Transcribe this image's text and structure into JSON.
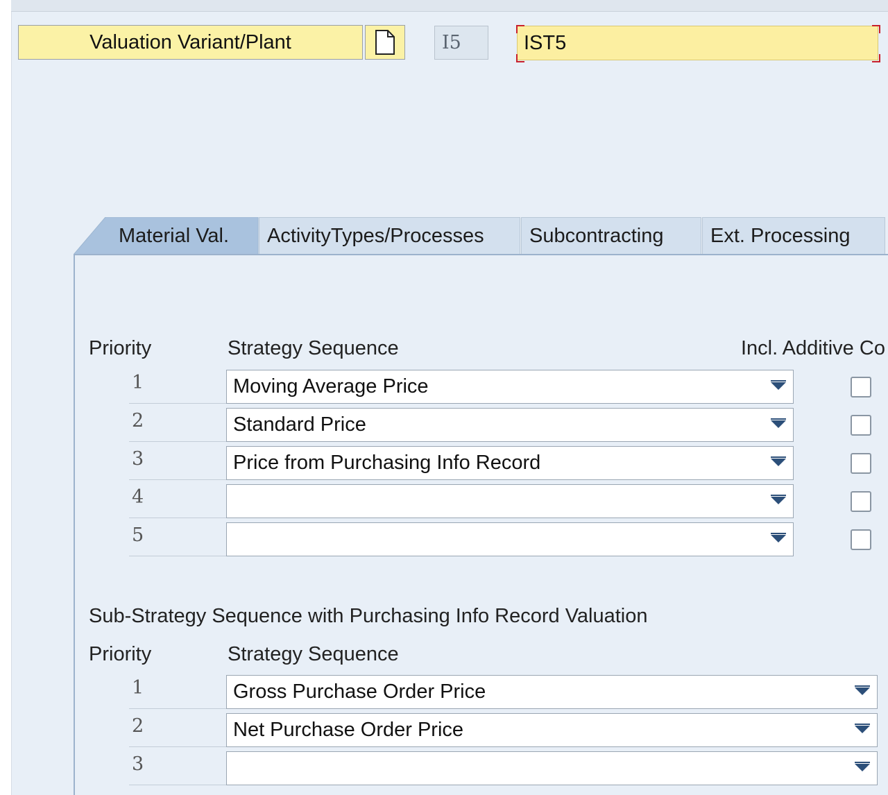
{
  "header": {
    "variant_button_label": "Valuation Variant/Plant",
    "variant_code": "I5",
    "plant_value": "IST5"
  },
  "tabs": [
    {
      "label": "Material Val.",
      "active": true
    },
    {
      "label": "ActivityTypes/Processes",
      "active": false
    },
    {
      "label": "Subcontracting",
      "active": false
    },
    {
      "label": "Ext. Processing",
      "active": false
    }
  ],
  "strategy": {
    "priority_header": "Priority",
    "sequence_header": "Strategy Sequence",
    "additive_header": "Incl. Additive Co",
    "rows": [
      {
        "priority": "1",
        "value": "Moving Average Price",
        "additive": false
      },
      {
        "priority": "2",
        "value": "Standard Price",
        "additive": false
      },
      {
        "priority": "3",
        "value": "Price from Purchasing Info Record",
        "additive": false
      },
      {
        "priority": "4",
        "value": "",
        "additive": false
      },
      {
        "priority": "5",
        "value": "",
        "additive": false
      }
    ]
  },
  "sub_strategy": {
    "title": "Sub-Strategy Sequence with Purchasing Info Record Valuation",
    "priority_header": "Priority",
    "sequence_header": "Strategy Sequence",
    "rows": [
      {
        "priority": "1",
        "value": "Gross Purchase Order Price"
      },
      {
        "priority": "2",
        "value": "Net Purchase Order Price"
      },
      {
        "priority": "3",
        "value": ""
      }
    ]
  },
  "colors": {
    "accent_yellow": "#fbf2a6",
    "active_tab": "#a9c2de",
    "dropdown_arrow": "#2c4f79",
    "focus_marker": "#c8202c"
  }
}
